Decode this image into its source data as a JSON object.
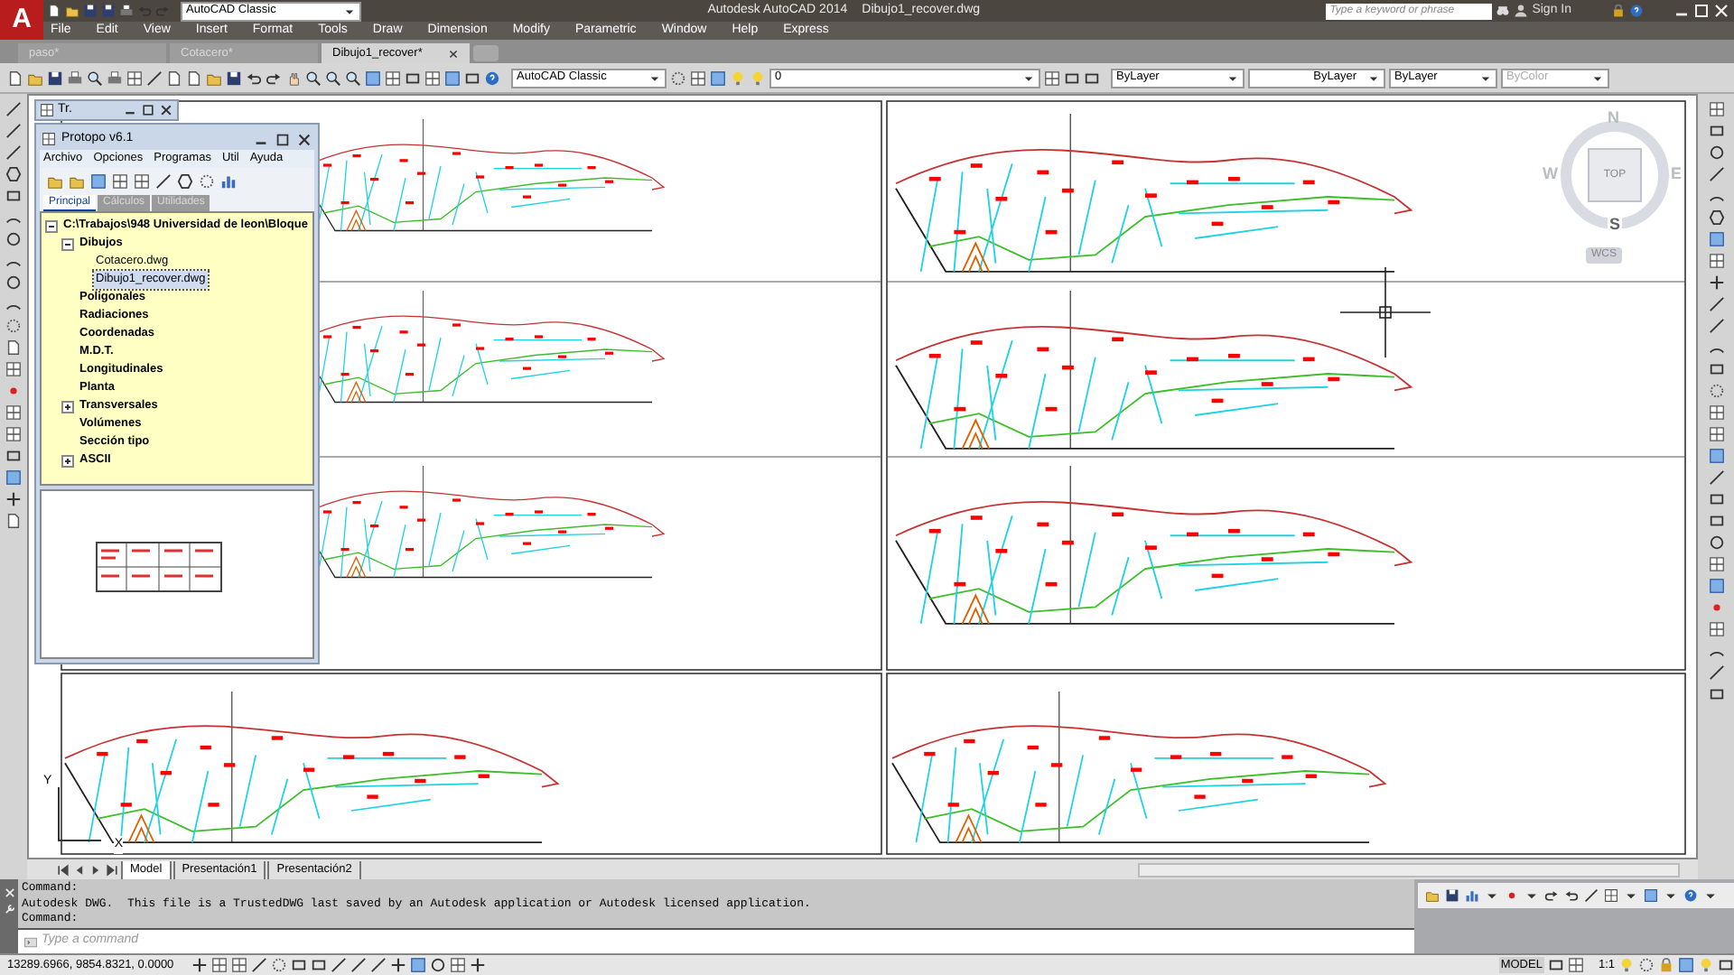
{
  "app_button": {
    "letter": "A"
  },
  "quick_access": {
    "workspace": "AutoCAD Classic"
  },
  "title": "Autodesk AutoCAD 2014",
  "file_name": "Dibujo1_recover.dwg",
  "search": {
    "placeholder": "Type a keyword or phrase"
  },
  "sign_in": "Sign In",
  "menu": [
    "File",
    "Edit",
    "View",
    "Insert",
    "Format",
    "Tools",
    "Draw",
    "Dimension",
    "Modify",
    "Parametric",
    "Window",
    "Help",
    "Express"
  ],
  "file_tabs": [
    {
      "label": "paso*",
      "selected": false
    },
    {
      "label": "Cotacero*",
      "selected": false
    },
    {
      "label": "Dibujo1_recover*",
      "selected": true
    }
  ],
  "toolbar": {
    "workspace": "AutoCAD Classic",
    "layer": "0",
    "color_setting": "ByLayer",
    "linetype": "ByLayer",
    "lineweight": "ByLayer",
    "plot_style": "ByColor",
    "plot_style_disabled": true
  },
  "mini_window": {
    "title": "Tr."
  },
  "protopo": {
    "title": "Protopo v6.1",
    "menu": [
      "Archivo",
      "Opciones",
      "Programas",
      "Util",
      "Ayuda"
    ],
    "tabs": [
      {
        "label": "Principal",
        "selected": true,
        "disabled": false
      },
      {
        "label": "Cálculos",
        "selected": false,
        "disabled": true
      },
      {
        "label": "Utilidades",
        "selected": false,
        "disabled": true
      }
    ],
    "tree": [
      {
        "label": "C:\\Trabajos\\948 Universidad de leon\\Bloque",
        "expanded": true,
        "selected": false,
        "children": [
          {
            "label": "Dibujos",
            "expanded": true,
            "selected": false,
            "children": [
              {
                "label": "Cotacero.dwg",
                "selected": false
              },
              {
                "label": "Dibujo1_recover.dwg",
                "selected": true
              }
            ]
          },
          {
            "label": "Poligonales",
            "selected": false
          },
          {
            "label": "Radiaciones",
            "selected": false
          },
          {
            "label": "Coordenadas",
            "selected": false
          },
          {
            "label": "M.D.T.",
            "selected": false
          },
          {
            "label": "Longitudinales",
            "selected": false
          },
          {
            "label": "Planta",
            "selected": false
          },
          {
            "label": "Transversales",
            "expanded": false,
            "selected": false
          },
          {
            "label": "Volúmenes",
            "selected": false
          },
          {
            "label": "Sección tipo",
            "selected": false
          },
          {
            "label": "ASCII",
            "expanded": false,
            "selected": false
          }
        ]
      }
    ]
  },
  "viewcube": {
    "north": "N",
    "south": "S",
    "east": "E",
    "west": "W",
    "face": "TOP",
    "ucs": "WCS"
  },
  "ucs_icon": {
    "x_label": "X",
    "y_label": "Y"
  },
  "layout_tabs": [
    {
      "label": "Model",
      "selected": true
    },
    {
      "label": "Presentación1",
      "selected": false
    },
    {
      "label": "Presentación2",
      "selected": false
    }
  ],
  "command_history": [
    "Command:",
    "Autodesk DWG.  This file is a TrustedDWG last saved by an Autodesk application or Autodesk licensed application.",
    "Command:"
  ],
  "command_input": {
    "placeholder": "Type a command"
  },
  "status_bar": {
    "coordinates": "13289.6966, 9854.8321, 0.0000",
    "space": "MODEL",
    "annotation_scale": "1:1"
  }
}
